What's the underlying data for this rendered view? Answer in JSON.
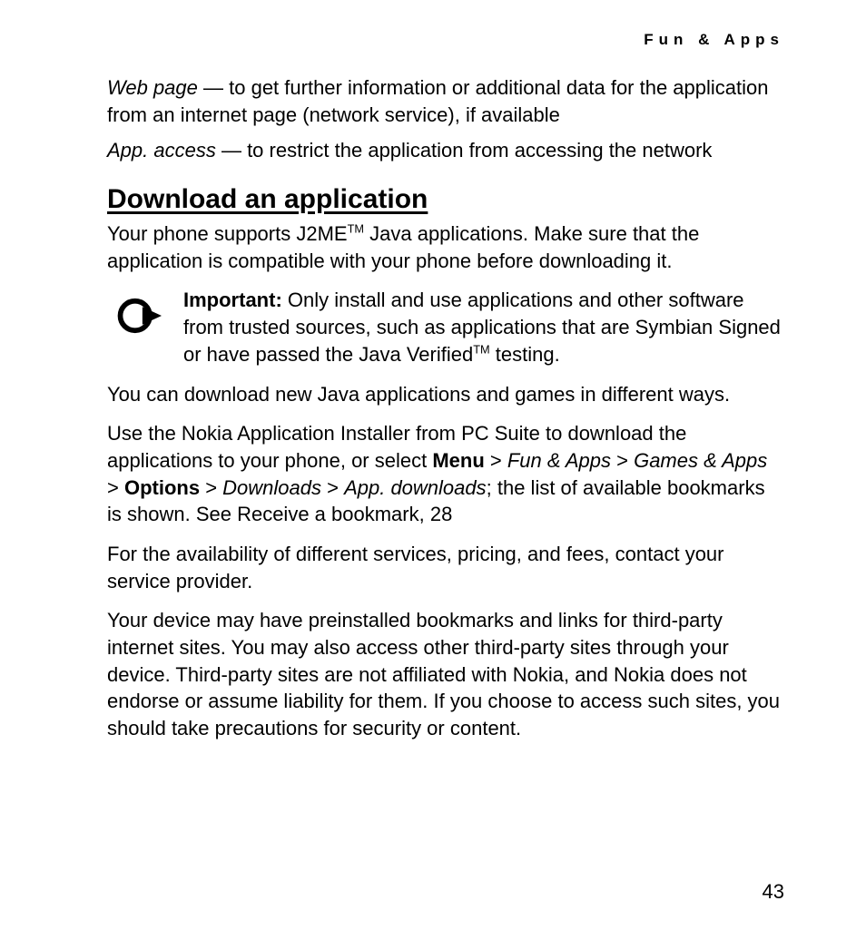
{
  "header": {
    "running_head": "Fun & Apps"
  },
  "intro": {
    "web_page_term": "Web page",
    "web_page_text": " — to get further information or additional data for the application from an internet page (network service), if available",
    "app_access_term": "App. access",
    "app_access_text": " — to restrict the application from accessing the network"
  },
  "section": {
    "heading": "Download an application",
    "support_pre": "Your phone supports J2ME",
    "support_sup": "TM",
    "support_post": " Java applications. Make sure that the application is compatible with your phone before downloading it."
  },
  "important": {
    "label": "Important:",
    "text_pre": " Only install and use applications and other software from trusted sources, such as applications that are Symbian Signed or have passed the Java Verified",
    "text_sup": "TM",
    "text_post": " testing."
  },
  "body": {
    "para1": "You can download new Java applications and games in different ways.",
    "para2_pre": "Use the Nokia Application Installer from PC Suite to download the applications to your phone, or select ",
    "menu": "Menu",
    "gt1": " > ",
    "fun_apps": "Fun & Apps",
    "gt2": " > ",
    "games_apps": "Games & Apps ",
    "gt3": " > ",
    "options": "Options",
    "gt4": " > ",
    "downloads": "Downloads",
    "gt5": " > ",
    "app_downloads": "App. downloads",
    "para2_post": "; the list of available bookmarks is shown. See Receive a bookmark, 28",
    "para3": "For the availability of different services, pricing, and fees, contact your service provider.",
    "para4": "Your device may have preinstalled bookmarks and links for third-party internet sites. You may also access other third-party sites through your device. Third-party sites are not affiliated with Nokia, and Nokia does not endorse or assume liability for them. If you choose to access such sites, you should take precautions for security or content."
  },
  "footer": {
    "page_number": "43"
  }
}
